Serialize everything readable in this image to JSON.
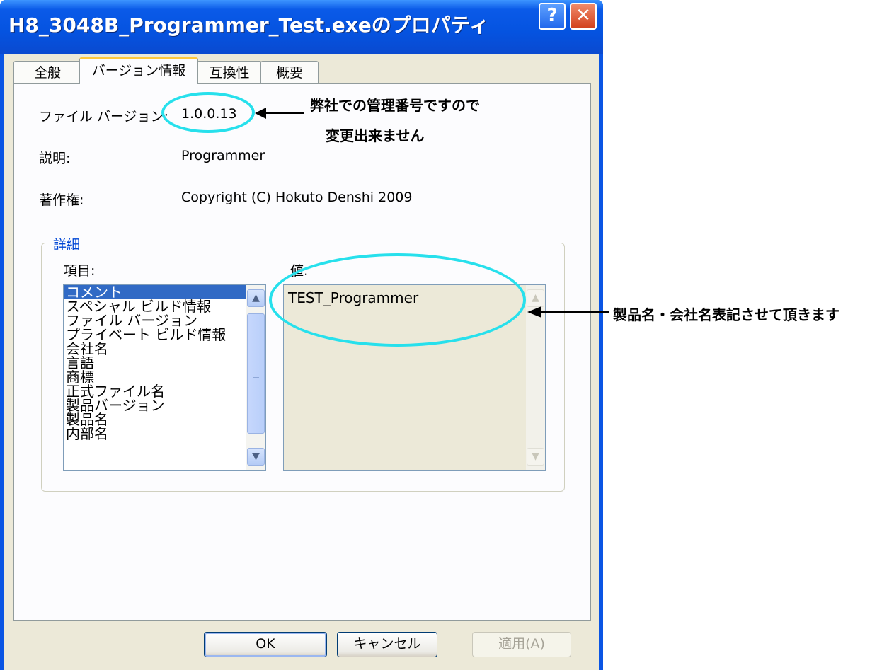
{
  "window": {
    "title": "H8_3048B_Programmer_Test.exeのプロパティ",
    "help_icon": "?",
    "close_icon": "✕"
  },
  "tabs": [
    {
      "label": "全般",
      "active": false
    },
    {
      "label": "バージョン情報",
      "active": true
    },
    {
      "label": "互換性",
      "active": false
    },
    {
      "label": "概要",
      "active": false
    }
  ],
  "info": {
    "file_version_label": "ファイル バージョン:",
    "file_version_value": "1.0.0.13",
    "description_label": "説明:",
    "description_value": "Programmer",
    "copyright_label": "著作権:",
    "copyright_value": "Copyright (C) Hokuto Denshi 2009"
  },
  "details": {
    "group_title": "詳細",
    "items_label": "項目:",
    "value_label": "値:",
    "items": [
      "コメント",
      "スペシャル ビルド情報",
      "ファイル バージョン",
      "プライベート ビルド情報",
      "会社名",
      "言語",
      "商標",
      "正式ファイル名",
      "製品バージョン",
      "製品名",
      "内部名"
    ],
    "selected_item": "コメント",
    "value": "TEST_Programmer"
  },
  "buttons": {
    "ok": "OK",
    "cancel": "キャンセル",
    "apply": "適用(A)"
  },
  "annotations": {
    "version_note_line1": "弊社での管理番号ですので",
    "version_note_line2": "変更出来ません",
    "value_note": "製品名・会社名表記させて頂きます",
    "highlight_color": "#27e0ec"
  }
}
